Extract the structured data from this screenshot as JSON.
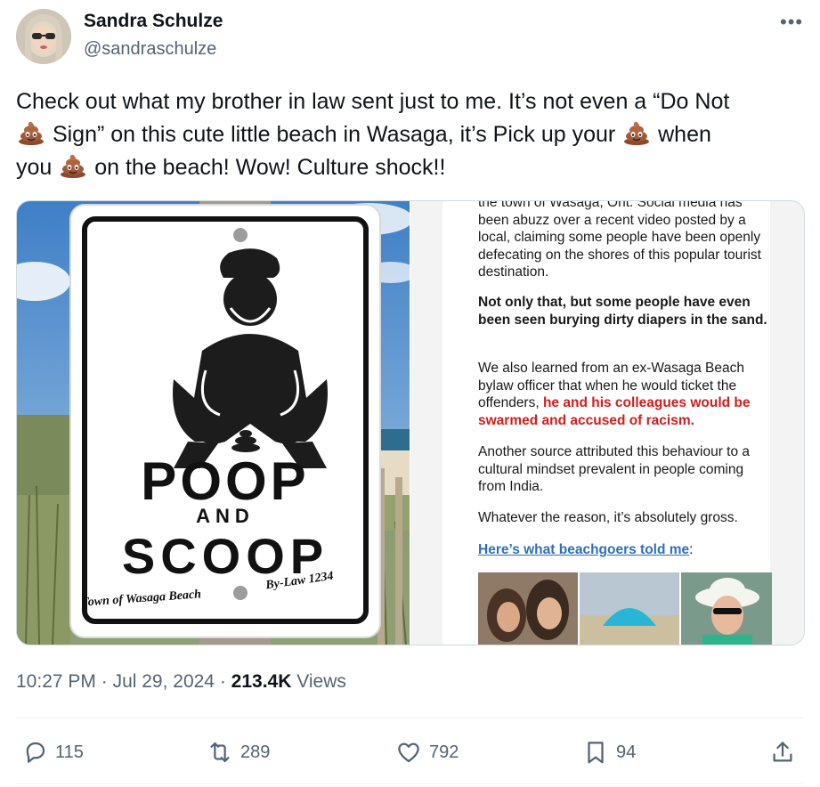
{
  "author": {
    "name": "Sandra Schulze",
    "handle": "@sandraschulze"
  },
  "more_icon": "more-icon",
  "tweet": {
    "seg1": "Check out what my brother in law sent just to me. It’s not even a “Do Not",
    "seg2": "Sign” on this cute little beach in Wasaga, it’s Pick up your",
    "seg3": "when",
    "seg4": "you",
    "seg5": "on the beach! Wow! Culture shock!!"
  },
  "sign": {
    "word1": "POOP",
    "word2": "AND",
    "word3": "SCOOP",
    "footer_left": "Town of Wasaga Beach",
    "footer_right": "By-Law 1234"
  },
  "article": {
    "p1": "the town of Wasaga, Ont. Social media has been abuzz over a recent video posted by a local, claiming some people have been openly defecating on the shores of this popular tourist destination.",
    "p2": "Not only that, but some people have even been seen burying dirty diapers in the sand.",
    "p3a": "We also learned from an ex-Wasaga Beach bylaw officer that when he would ticket the offenders, ",
    "p3b": "he and his colleagues would be swarmed and accused of racism.",
    "p4": "Another source attributed this behaviour to a cultural mindset prevalent in people coming from India.",
    "p5": "Whatever the reason, it’s absolutely gross.",
    "link": "Here’s what beachgoers told me",
    "link_suffix": ":"
  },
  "meta": {
    "time": "10:27 PM",
    "sep1": " · ",
    "date": "Jul 29, 2024",
    "sep2": " · ",
    "views": "213.4K",
    "views_label": " Views"
  },
  "actions": {
    "replies": "115",
    "reposts": "289",
    "likes": "792",
    "bookmarks": "94"
  },
  "colors": {
    "text": "#0f1419",
    "secondary": "#536471",
    "border": "#cfd9de",
    "article_red": "#d11d1d",
    "article_link": "#2f6fb8"
  }
}
